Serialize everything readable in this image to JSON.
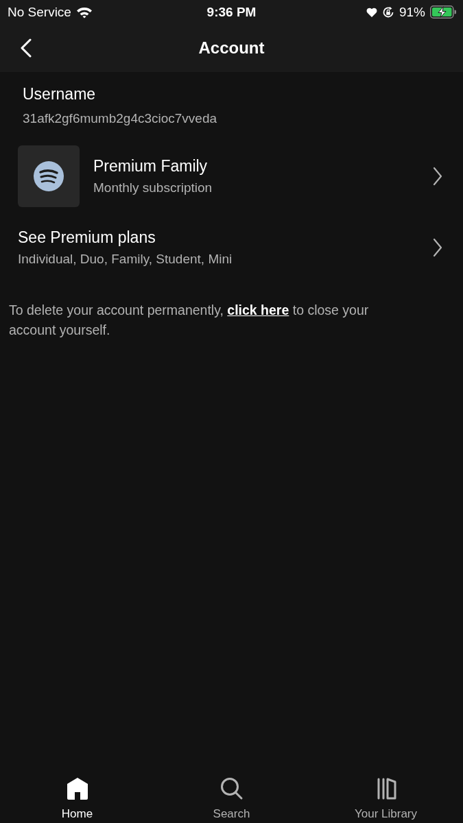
{
  "status_bar": {
    "carrier": "No Service",
    "time": "9:36 PM",
    "battery_percent": "91%"
  },
  "header": {
    "title": "Account"
  },
  "username": {
    "label": "Username",
    "value": "31afk2gf6mumb2g4c3cioc7vveda"
  },
  "plans": [
    {
      "kind": "current",
      "title": "Premium Family",
      "subtitle": "Monthly subscription"
    },
    {
      "kind": "browse",
      "title": "See Premium plans",
      "subtitle": "Individual, Duo, Family, Student, Mini"
    }
  ],
  "delete_note": {
    "before": "To delete your account permanently,",
    "link": "click here",
    "after": "to close your account yourself."
  },
  "tabs": [
    {
      "kind": "home",
      "label": "Home",
      "selected": true
    },
    {
      "kind": "search",
      "label": "Search",
      "selected": false
    },
    {
      "kind": "library",
      "label": "Your Library",
      "selected": false
    }
  ]
}
